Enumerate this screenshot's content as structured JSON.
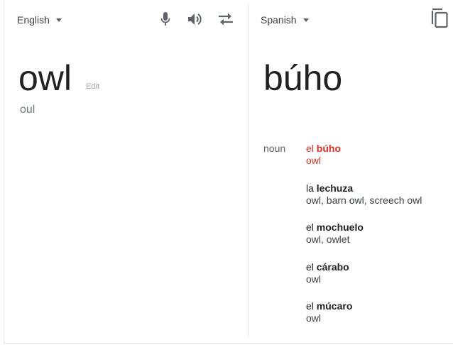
{
  "source": {
    "language": "English",
    "word": "owl",
    "edit_label": "Edit",
    "transliteration": "oul"
  },
  "target": {
    "language": "Spanish",
    "word": "búho"
  },
  "toolbar": {
    "mic_icon": "microphone-icon",
    "speaker_icon": "speaker-icon",
    "swap_icon": "swap-languages-icon",
    "copy_icon": "copy-icon"
  },
  "dictionary": {
    "part_of_speech": "noun",
    "entries": [
      {
        "article": "el",
        "word": "búho",
        "synonyms": "owl"
      },
      {
        "article": "la",
        "word": "lechuza",
        "synonyms": "owl, barn owl, screech owl"
      },
      {
        "article": "el",
        "word": "mochuelo",
        "synonyms": "owl, owlet"
      },
      {
        "article": "el",
        "word": "cárabo",
        "synonyms": "owl"
      },
      {
        "article": "el",
        "word": "múcaro",
        "synonyms": "owl"
      }
    ]
  },
  "colors": {
    "highlight": "#d93025",
    "text": "#202124",
    "muted": "#70757a"
  }
}
